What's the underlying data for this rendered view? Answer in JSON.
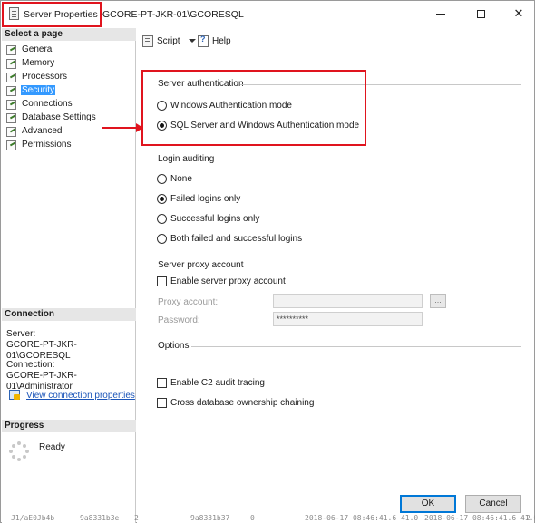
{
  "window": {
    "title_prefix": "Server Properties -",
    "title_rest": "GCORE-PT-JKR-01\\GCORESQL",
    "minimize": "minimize",
    "maximize": "maximize",
    "close": "✕"
  },
  "sidebar": {
    "select_page_heading": "Select a page",
    "pages": [
      {
        "label": "General"
      },
      {
        "label": "Memory"
      },
      {
        "label": "Processors"
      },
      {
        "label": "Security"
      },
      {
        "label": "Connections"
      },
      {
        "label": "Database Settings"
      },
      {
        "label": "Advanced"
      },
      {
        "label": "Permissions"
      }
    ],
    "selected_page": "Security",
    "connection_heading": "Connection",
    "server_label": "Server:",
    "server_value": "GCORE-PT-JKR-01\\GCORESQL",
    "connection_label": "Connection:",
    "connection_value": "GCORE-PT-JKR-01\\Administrator",
    "view_connection_link": "View connection properties",
    "progress_heading": "Progress",
    "progress_status": "Ready"
  },
  "toolbar": {
    "script_label": "Script",
    "help_label": "Help"
  },
  "security": {
    "server_auth_title": "Server authentication",
    "auth_windows": "Windows Authentication mode",
    "auth_mixed": "SQL Server and Windows Authentication mode",
    "login_auditing_title": "Login auditing",
    "audit_none": "None",
    "audit_failed": "Failed logins only",
    "audit_successful": "Successful logins only",
    "audit_both": "Both failed and successful logins",
    "proxy_title": "Server proxy account",
    "proxy_enable": "Enable server proxy account",
    "proxy_account_label": "Proxy account:",
    "proxy_account_value": "",
    "password_label": "Password:",
    "password_value": "**********",
    "browse_label": "...",
    "options_title": "Options",
    "c2_audit": "Enable C2 audit tracing",
    "cross_db": "Cross database ownership chaining"
  },
  "buttons": {
    "ok": "OK",
    "cancel": "Cancel"
  },
  "behind_window_text": [
    "J1/aE0Jb4b",
    "9a8331b3e",
    "2",
    "9a8331b37",
    "0",
    "2018-06-17 08:46:41.6 41.0",
    "2018-06-17 08:46:41.6 41.0",
    "2"
  ]
}
